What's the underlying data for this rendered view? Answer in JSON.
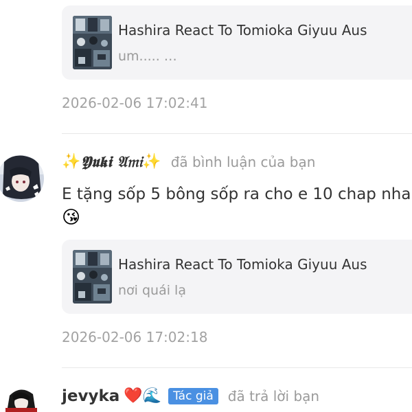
{
  "notifications": [
    {
      "story": {
        "title": "Hashira React To Tomioka Giyuu Aus",
        "excerpt": "um..... …"
      },
      "timestamp": "2026-02-06 17:02:41"
    },
    {
      "user": {
        "name": "𝖄𝖚𝖐𝖎 𝔄𝔪𝔦",
        "name_prefix": "✨",
        "name_suffix": "✨"
      },
      "action": "đã bình luận của bạn",
      "comment": "E tặng sốp 5 bông sốp ra cho e 10 chap nha",
      "comment_emoji": "😘",
      "story": {
        "title": "Hashira React To Tomioka Giyuu Aus",
        "excerpt": "nơi quái lạ"
      },
      "timestamp": "2026-02-06 17:02:18"
    },
    {
      "user": {
        "name": "jevyka",
        "emojis": "❤️🌊",
        "badge": "Tác giả"
      },
      "action": "đã trả lời bạn"
    }
  ],
  "colors": {
    "card_bg": "#f4f4f6",
    "badge_bg": "#4a90e2",
    "muted_text": "#9a9a9a",
    "primary_text": "#333333"
  },
  "icons": {
    "story_cover": "story-cover-thumbnail",
    "avatar_1": "user-avatar",
    "avatar_2": "user-avatar"
  }
}
